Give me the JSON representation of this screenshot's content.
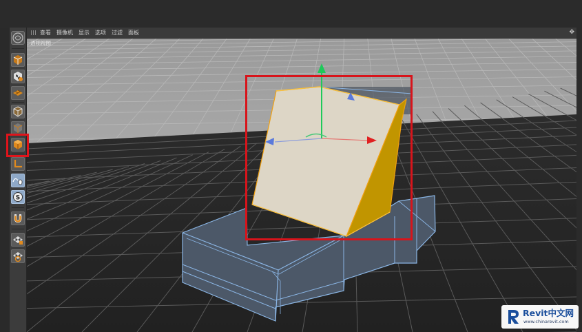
{
  "menubar": {
    "items": [
      "查看",
      "摄像机",
      "显示",
      "选项",
      "过滤",
      "面板"
    ]
  },
  "viewport": {
    "view_name": "透视视图"
  },
  "toolbar": {
    "tools": [
      {
        "name": "cube-tool-icon"
      },
      {
        "name": "checker-cube-tool-icon"
      },
      {
        "name": "checker-plane-tool-icon"
      },
      {
        "name": "cube-outline-tool-icon"
      },
      {
        "name": "cube-gray-tool-icon"
      },
      {
        "name": "cube-orange-tool-icon",
        "selected": true
      },
      {
        "name": "axis-tool-icon"
      },
      {
        "name": "spline-mouse-tool-icon"
      },
      {
        "name": "s-circle-tool-icon"
      },
      {
        "name": "magnet-tool-icon"
      },
      {
        "name": "checker-lock-tool-icon"
      },
      {
        "name": "checker-target-tool-icon"
      }
    ]
  },
  "watermark": {
    "brand": "Revit中文网",
    "url": "www.chinarevit.com"
  },
  "colors": {
    "selection_face_front": "#ddd6c6",
    "selection_face_side": "#c19500",
    "selection_edges": "#f0a010",
    "base_face": "#4d5a6a",
    "base_edges": "#89b4e2",
    "highlight_box": "#d8141b",
    "axis_y": "#1fc95a",
    "axis_x": "#e02020",
    "axis_z": "#3b63e0"
  }
}
